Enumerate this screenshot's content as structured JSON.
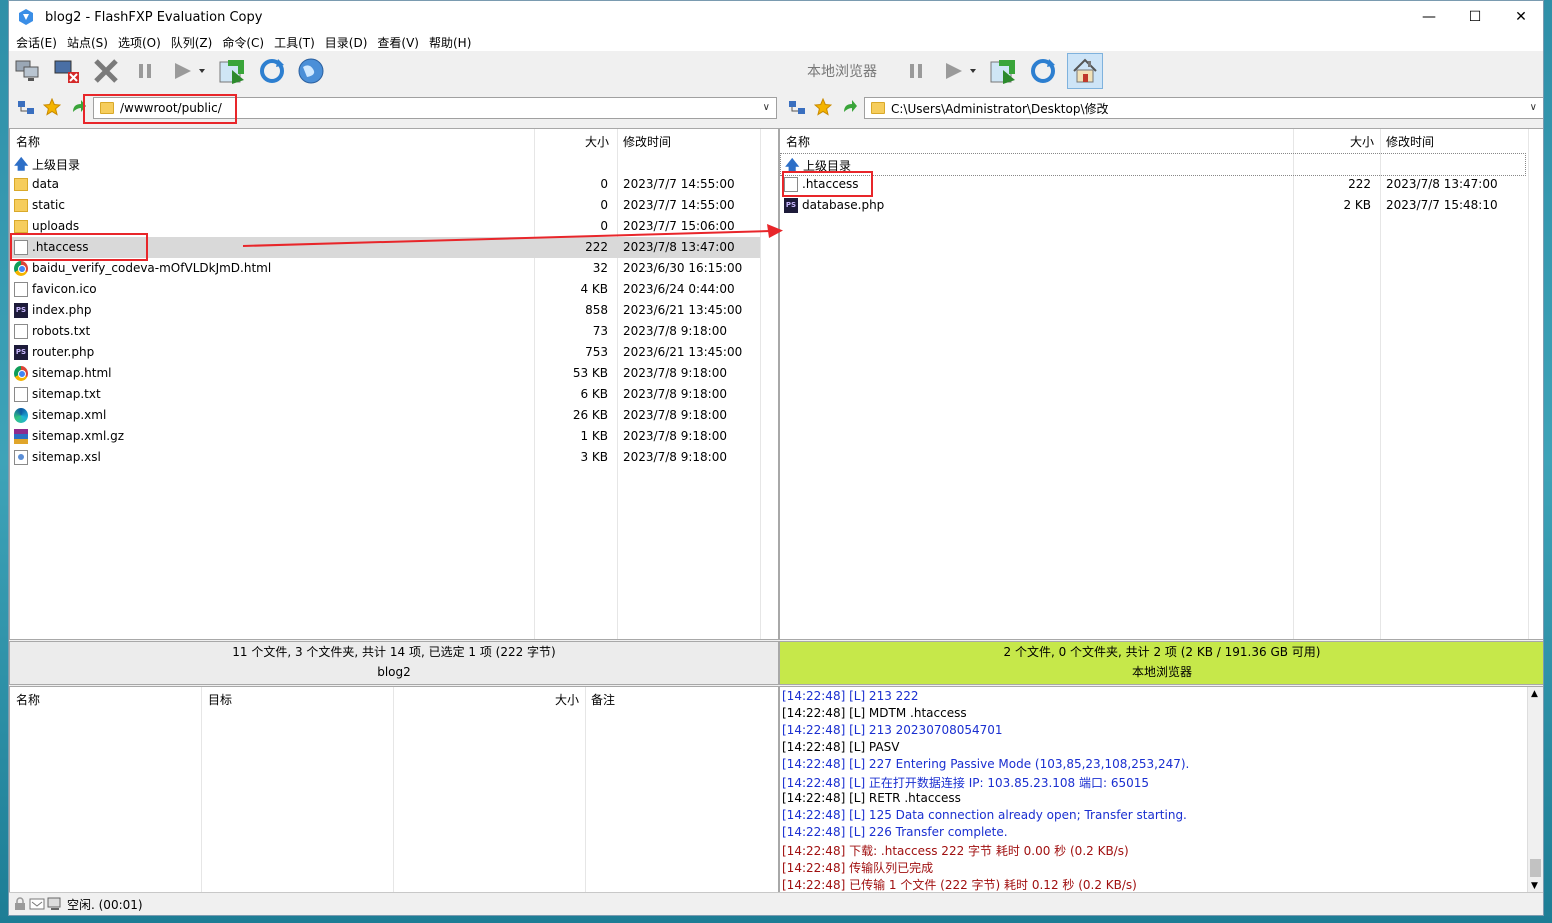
{
  "window": {
    "title": "blog2 - FlashFXP Evaluation Copy"
  },
  "menu": [
    "会话(E)",
    "站点(S)",
    "选项(O)",
    "队列(Z)",
    "命令(C)",
    "工具(T)",
    "目录(D)",
    "查看(V)",
    "帮助(H)"
  ],
  "right_toolbar_label": "本地浏览器",
  "remote": {
    "path": "/wwwroot/public/",
    "headers": {
      "name": "名称",
      "size": "大小",
      "mtime": "修改时间"
    },
    "files": [
      {
        "name": "上级目录",
        "size": "",
        "mtime": "",
        "icon": "parent-dir-icon"
      },
      {
        "name": "data",
        "size": "0",
        "mtime": "2023/7/7 14:55:00",
        "icon": "folder-icon"
      },
      {
        "name": "static",
        "size": "0",
        "mtime": "2023/7/7 14:55:00",
        "icon": "folder-icon"
      },
      {
        "name": "uploads",
        "size": "0",
        "mtime": "2023/7/7 15:06:00",
        "icon": "folder-icon"
      },
      {
        "name": ".htaccess",
        "size": "222",
        "mtime": "2023/7/8 13:47:00",
        "icon": "file-icon"
      },
      {
        "name": "baidu_verify_codeva-mOfVLDkJmD.html",
        "size": "32",
        "mtime": "2023/6/30 16:15:00",
        "icon": "chrome-icon"
      },
      {
        "name": "favicon.ico",
        "size": "4 KB",
        "mtime": "2023/6/24 0:44:00",
        "icon": "file-icon"
      },
      {
        "name": "index.php",
        "size": "858",
        "mtime": "2023/6/21 13:45:00",
        "icon": "phpstorm-icon"
      },
      {
        "name": "robots.txt",
        "size": "73",
        "mtime": "2023/7/8 9:18:00",
        "icon": "text-file-icon"
      },
      {
        "name": "router.php",
        "size": "753",
        "mtime": "2023/6/21 13:45:00",
        "icon": "phpstorm-icon"
      },
      {
        "name": "sitemap.html",
        "size": "53 KB",
        "mtime": "2023/7/8 9:18:00",
        "icon": "chrome-icon"
      },
      {
        "name": "sitemap.txt",
        "size": "6 KB",
        "mtime": "2023/7/8 9:18:00",
        "icon": "text-file-icon"
      },
      {
        "name": "sitemap.xml",
        "size": "26 KB",
        "mtime": "2023/7/8 9:18:00",
        "icon": "edge-icon"
      },
      {
        "name": "sitemap.xml.gz",
        "size": "1 KB",
        "mtime": "2023/7/8 9:18:00",
        "icon": "winrar-icon"
      },
      {
        "name": "sitemap.xsl",
        "size": "3 KB",
        "mtime": "2023/7/8 9:18:00",
        "icon": "xsl-file-icon"
      }
    ],
    "status_line1": "11 个文件, 3 个文件夹, 共计 14 项, 已选定 1 项 (222 字节)",
    "status_line2": "blog2"
  },
  "local": {
    "path": "C:\\Users\\Administrator\\Desktop\\修改",
    "headers": {
      "name": "名称",
      "size": "大小",
      "mtime": "修改时间"
    },
    "files": [
      {
        "name": "上级目录",
        "size": "",
        "mtime": "",
        "icon": "parent-dir-icon"
      },
      {
        "name": ".htaccess",
        "size": "222",
        "mtime": "2023/7/8 13:47:00",
        "icon": "file-icon"
      },
      {
        "name": "database.php",
        "size": "2 KB",
        "mtime": "2023/7/7 15:48:10",
        "icon": "phpstorm-icon"
      }
    ],
    "status_line1": "2 个文件, 0 个文件夹, 共计 2 项 (2 KB / 191.36 GB 可用)",
    "status_line2": "本地浏览器"
  },
  "queue": {
    "headers": {
      "name": "名称",
      "target": "目标",
      "size": "大小",
      "note": "备注"
    }
  },
  "log": [
    {
      "text": "[14:22:48]  [L] 213 222",
      "color": "blue"
    },
    {
      "text": "[14:22:48]  [L] MDTM .htaccess",
      "color": "black"
    },
    {
      "text": "[14:22:48]  [L] 213 20230708054701",
      "color": "blue"
    },
    {
      "text": "[14:22:48]  [L] PASV",
      "color": "black"
    },
    {
      "text": "[14:22:48]  [L] 227 Entering Passive Mode (103,85,23,108,253,247).",
      "color": "blue"
    },
    {
      "text": "[14:22:48]  [L] 正在打开数据连接 IP: 103.85.23.108 端口: 65015",
      "color": "blue"
    },
    {
      "text": "[14:22:48]  [L] RETR .htaccess",
      "color": "black"
    },
    {
      "text": "[14:22:48]  [L] 125 Data connection already open; Transfer starting.",
      "color": "blue"
    },
    {
      "text": "[14:22:48]  [L] 226 Transfer complete.",
      "color": "blue"
    },
    {
      "text": "[14:22:48]  下载: .htaccess 222 字节 耗时 0.00 秒 (0.2 KB/s)",
      "color": "red"
    },
    {
      "text": "[14:22:48]  传输队列已完成",
      "color": "red"
    },
    {
      "text": "[14:22:48]  已传输 1 个文件 (222 字节) 耗时 0.12 秒 (0.2 KB/s)",
      "color": "red"
    }
  ],
  "bottom_status": "空闲. (00:01)",
  "colors": {
    "local_status_bg": "#c6e84a",
    "highlight_red": "#e8262a",
    "log_blue": "#1a2fd0",
    "log_red": "#a01010"
  }
}
